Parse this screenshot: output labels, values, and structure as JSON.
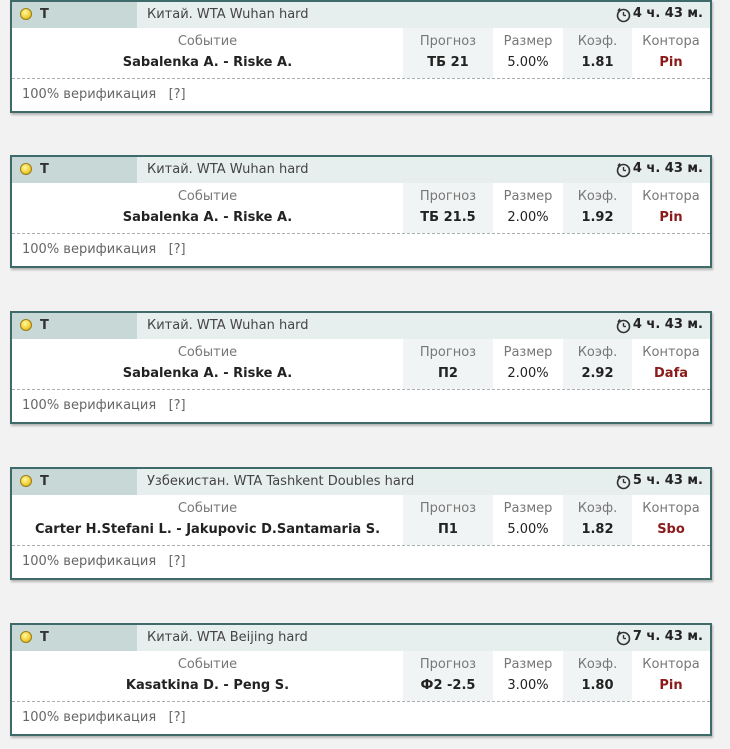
{
  "columns": {
    "event": "Событие",
    "prediction": "Прогноз",
    "size": "Размер",
    "coef": "Коэф.",
    "bookmaker": "Контора"
  },
  "tips": [
    {
      "sport": "Т",
      "league": "Китай. WTA Wuhan hard",
      "time": "4 ч. 43 м.",
      "event": "Sabalenka A. - Riske A.",
      "prediction": "ТБ 21",
      "size": "5.00%",
      "coef": "1.81",
      "bookmaker": "Pin",
      "verification": "100% верификация",
      "help": "[?]"
    },
    {
      "sport": "Т",
      "league": "Китай. WTA Wuhan hard",
      "time": "4 ч. 43 м.",
      "event": "Sabalenka A. - Riske A.",
      "prediction": "ТБ 21.5",
      "size": "2.00%",
      "coef": "1.92",
      "bookmaker": "Pin",
      "verification": "100% верификация",
      "help": "[?]"
    },
    {
      "sport": "Т",
      "league": "Китай. WTA Wuhan hard",
      "time": "4 ч. 43 м.",
      "event": "Sabalenka A. - Riske A.",
      "prediction": "П2",
      "size": "2.00%",
      "coef": "2.92",
      "bookmaker": "Dafa",
      "verification": "100% верификация",
      "help": "[?]"
    },
    {
      "sport": "Т",
      "league": "Узбекистан. WTA Tashkent Doubles hard",
      "time": "5 ч. 43 м.",
      "event": "Carter H.Stefani L. - Jakupovic D.Santamaria S.",
      "prediction": "П1",
      "size": "5.00%",
      "coef": "1.82",
      "bookmaker": "Sbo",
      "verification": "100% верификация",
      "help": "[?]"
    },
    {
      "sport": "Т",
      "league": "Китай. WTA Beijing hard",
      "time": "7 ч. 43 м.",
      "event": "Kasatkina D. - Peng S.",
      "prediction": "Ф2 -2.5",
      "size": "3.00%",
      "coef": "1.80",
      "bookmaker": "Pin",
      "verification": "100% верификация",
      "help": "[?]"
    }
  ],
  "icons": {
    "sport": "tennis-ball-icon",
    "time": "stopwatch-icon"
  },
  "colors": {
    "border": "#3e6a6a",
    "header_bg": "#e7efee",
    "sport_bg": "#c7d8d6",
    "bookmaker": "#8b1a1a"
  }
}
